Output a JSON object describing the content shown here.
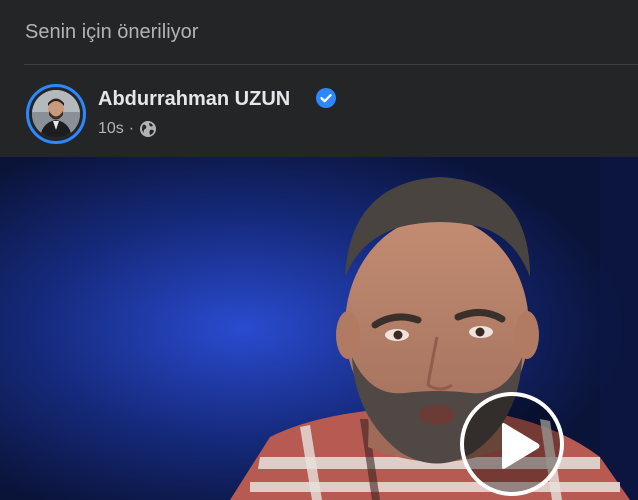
{
  "suggestion": {
    "label": "Senin için öneriliyor"
  },
  "post": {
    "author_name": "Abdurrahman UZUN",
    "verified": true,
    "time": "10s",
    "separator": "·",
    "audience_icon": "globe-icon"
  },
  "video": {
    "play_icon": "play-icon"
  },
  "colors": {
    "background": "#242526",
    "primary_text": "#e4e6eb",
    "secondary_text": "#b0b3b8",
    "accent": "#2d88ff",
    "video_bg": "#0f1e4d"
  }
}
